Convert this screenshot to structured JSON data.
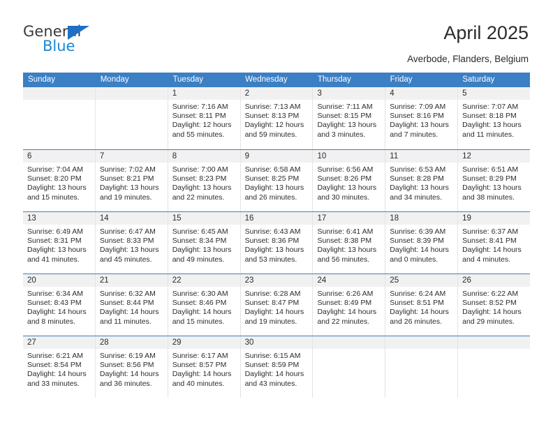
{
  "brand": {
    "name_top": "General",
    "name_bottom": "Blue",
    "triangle_color": "#1f6fc4",
    "blue_text_color": "#1b87d4"
  },
  "header": {
    "title": "April 2025",
    "location": "Averbode, Flanders, Belgium"
  },
  "colors": {
    "header_blue": "#3b7fc4",
    "date_band": "#f1f1f1",
    "text": "#2b2b2b"
  },
  "calendar": {
    "weekdays": [
      "Sunday",
      "Monday",
      "Tuesday",
      "Wednesday",
      "Thursday",
      "Friday",
      "Saturday"
    ],
    "weeks": [
      [
        {
          "date": "",
          "lines": []
        },
        {
          "date": "",
          "lines": []
        },
        {
          "date": "1",
          "lines": [
            "Sunrise: 7:16 AM",
            "Sunset: 8:11 PM",
            "Daylight: 12 hours",
            "and 55 minutes."
          ]
        },
        {
          "date": "2",
          "lines": [
            "Sunrise: 7:13 AM",
            "Sunset: 8:13 PM",
            "Daylight: 12 hours",
            "and 59 minutes."
          ]
        },
        {
          "date": "3",
          "lines": [
            "Sunrise: 7:11 AM",
            "Sunset: 8:15 PM",
            "Daylight: 13 hours",
            "and 3 minutes."
          ]
        },
        {
          "date": "4",
          "lines": [
            "Sunrise: 7:09 AM",
            "Sunset: 8:16 PM",
            "Daylight: 13 hours",
            "and 7 minutes."
          ]
        },
        {
          "date": "5",
          "lines": [
            "Sunrise: 7:07 AM",
            "Sunset: 8:18 PM",
            "Daylight: 13 hours",
            "and 11 minutes."
          ]
        }
      ],
      [
        {
          "date": "6",
          "lines": [
            "Sunrise: 7:04 AM",
            "Sunset: 8:20 PM",
            "Daylight: 13 hours",
            "and 15 minutes."
          ]
        },
        {
          "date": "7",
          "lines": [
            "Sunrise: 7:02 AM",
            "Sunset: 8:21 PM",
            "Daylight: 13 hours",
            "and 19 minutes."
          ]
        },
        {
          "date": "8",
          "lines": [
            "Sunrise: 7:00 AM",
            "Sunset: 8:23 PM",
            "Daylight: 13 hours",
            "and 22 minutes."
          ]
        },
        {
          "date": "9",
          "lines": [
            "Sunrise: 6:58 AM",
            "Sunset: 8:25 PM",
            "Daylight: 13 hours",
            "and 26 minutes."
          ]
        },
        {
          "date": "10",
          "lines": [
            "Sunrise: 6:56 AM",
            "Sunset: 8:26 PM",
            "Daylight: 13 hours",
            "and 30 minutes."
          ]
        },
        {
          "date": "11",
          "lines": [
            "Sunrise: 6:53 AM",
            "Sunset: 8:28 PM",
            "Daylight: 13 hours",
            "and 34 minutes."
          ]
        },
        {
          "date": "12",
          "lines": [
            "Sunrise: 6:51 AM",
            "Sunset: 8:29 PM",
            "Daylight: 13 hours",
            "and 38 minutes."
          ]
        }
      ],
      [
        {
          "date": "13",
          "lines": [
            "Sunrise: 6:49 AM",
            "Sunset: 8:31 PM",
            "Daylight: 13 hours",
            "and 41 minutes."
          ]
        },
        {
          "date": "14",
          "lines": [
            "Sunrise: 6:47 AM",
            "Sunset: 8:33 PM",
            "Daylight: 13 hours",
            "and 45 minutes."
          ]
        },
        {
          "date": "15",
          "lines": [
            "Sunrise: 6:45 AM",
            "Sunset: 8:34 PM",
            "Daylight: 13 hours",
            "and 49 minutes."
          ]
        },
        {
          "date": "16",
          "lines": [
            "Sunrise: 6:43 AM",
            "Sunset: 8:36 PM",
            "Daylight: 13 hours",
            "and 53 minutes."
          ]
        },
        {
          "date": "17",
          "lines": [
            "Sunrise: 6:41 AM",
            "Sunset: 8:38 PM",
            "Daylight: 13 hours",
            "and 56 minutes."
          ]
        },
        {
          "date": "18",
          "lines": [
            "Sunrise: 6:39 AM",
            "Sunset: 8:39 PM",
            "Daylight: 14 hours",
            "and 0 minutes."
          ]
        },
        {
          "date": "19",
          "lines": [
            "Sunrise: 6:37 AM",
            "Sunset: 8:41 PM",
            "Daylight: 14 hours",
            "and 4 minutes."
          ]
        }
      ],
      [
        {
          "date": "20",
          "lines": [
            "Sunrise: 6:34 AM",
            "Sunset: 8:43 PM",
            "Daylight: 14 hours",
            "and 8 minutes."
          ]
        },
        {
          "date": "21",
          "lines": [
            "Sunrise: 6:32 AM",
            "Sunset: 8:44 PM",
            "Daylight: 14 hours",
            "and 11 minutes."
          ]
        },
        {
          "date": "22",
          "lines": [
            "Sunrise: 6:30 AM",
            "Sunset: 8:46 PM",
            "Daylight: 14 hours",
            "and 15 minutes."
          ]
        },
        {
          "date": "23",
          "lines": [
            "Sunrise: 6:28 AM",
            "Sunset: 8:47 PM",
            "Daylight: 14 hours",
            "and 19 minutes."
          ]
        },
        {
          "date": "24",
          "lines": [
            "Sunrise: 6:26 AM",
            "Sunset: 8:49 PM",
            "Daylight: 14 hours",
            "and 22 minutes."
          ]
        },
        {
          "date": "25",
          "lines": [
            "Sunrise: 6:24 AM",
            "Sunset: 8:51 PM",
            "Daylight: 14 hours",
            "and 26 minutes."
          ]
        },
        {
          "date": "26",
          "lines": [
            "Sunrise: 6:22 AM",
            "Sunset: 8:52 PM",
            "Daylight: 14 hours",
            "and 29 minutes."
          ]
        }
      ],
      [
        {
          "date": "27",
          "lines": [
            "Sunrise: 6:21 AM",
            "Sunset: 8:54 PM",
            "Daylight: 14 hours",
            "and 33 minutes."
          ]
        },
        {
          "date": "28",
          "lines": [
            "Sunrise: 6:19 AM",
            "Sunset: 8:56 PM",
            "Daylight: 14 hours",
            "and 36 minutes."
          ]
        },
        {
          "date": "29",
          "lines": [
            "Sunrise: 6:17 AM",
            "Sunset: 8:57 PM",
            "Daylight: 14 hours",
            "and 40 minutes."
          ]
        },
        {
          "date": "30",
          "lines": [
            "Sunrise: 6:15 AM",
            "Sunset: 8:59 PM",
            "Daylight: 14 hours",
            "and 43 minutes."
          ]
        },
        {
          "date": "",
          "lines": []
        },
        {
          "date": "",
          "lines": []
        },
        {
          "date": "",
          "lines": []
        }
      ]
    ]
  }
}
